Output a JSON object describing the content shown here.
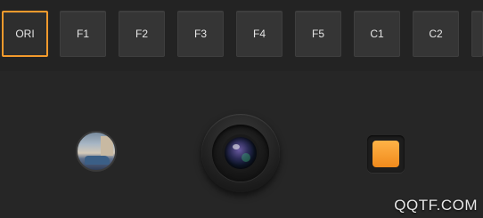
{
  "filters": [
    {
      "label": "ORI",
      "selected": true
    },
    {
      "label": "F1"
    },
    {
      "label": "F2"
    },
    {
      "label": "F3"
    },
    {
      "label": "F4"
    },
    {
      "label": "F5"
    },
    {
      "label": "C1"
    },
    {
      "label": "C2"
    }
  ],
  "controls": {
    "gallery_icon": "photo-thumbnail-icon",
    "shutter_icon": "camera-lens-icon",
    "record_icon": "record-stop-icon"
  },
  "watermark": "QQTF.COM",
  "colors": {
    "accent": "#f39a2c",
    "background": "#262626",
    "button": "#353535"
  }
}
